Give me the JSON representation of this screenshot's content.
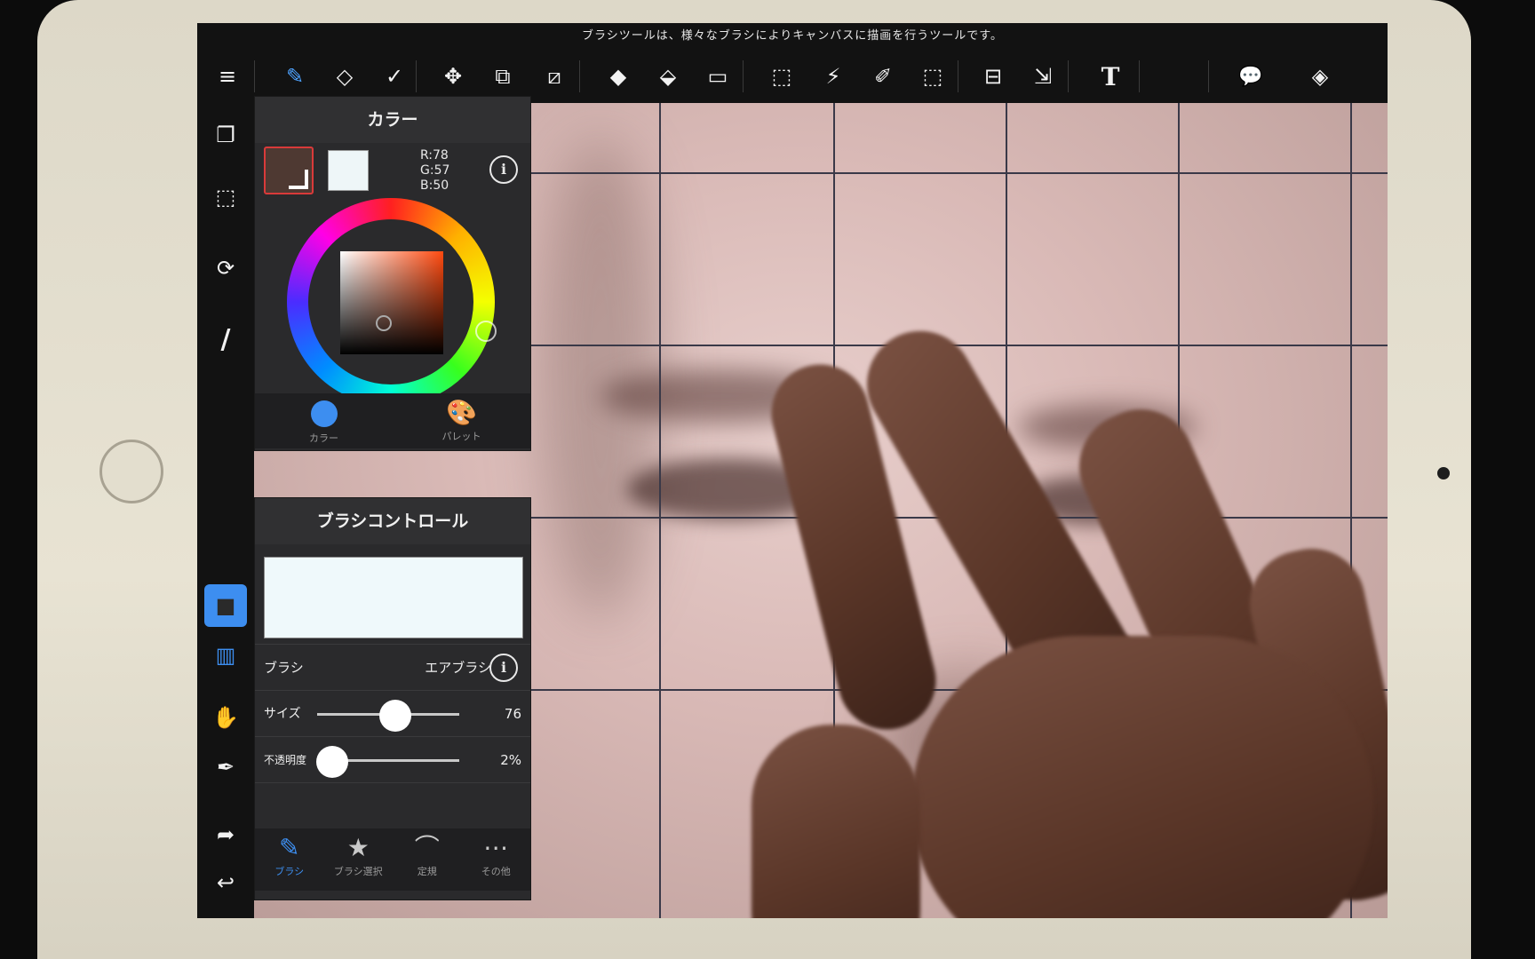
{
  "tipbar": {
    "text": "ブラシツールは、様々なブラシによりキャンバスに描画を行うツールです。"
  },
  "toolbar": {
    "items": [
      {
        "name": "menu-icon",
        "glyph": "≡"
      },
      {
        "name": "brush-icon",
        "glyph": "✎"
      },
      {
        "name": "eraser-icon",
        "glyph": "◇"
      },
      {
        "name": "smudge-icon",
        "glyph": "✓"
      },
      {
        "name": "move-icon",
        "glyph": "✥"
      },
      {
        "name": "transform-icon",
        "glyph": "⧉"
      },
      {
        "name": "distort-icon",
        "glyph": "⧄"
      },
      {
        "name": "shape-fill-icon",
        "glyph": "◆"
      },
      {
        "name": "bucket-icon",
        "glyph": "⬙"
      },
      {
        "name": "gradient-icon",
        "glyph": "▭"
      },
      {
        "name": "select-rect-icon",
        "glyph": "⬚"
      },
      {
        "name": "magic-wand-icon",
        "glyph": "⚡"
      },
      {
        "name": "select-pen-icon",
        "glyph": "✐"
      },
      {
        "name": "select-eraser-icon",
        "glyph": "⬚"
      },
      {
        "name": "frame-icon",
        "glyph": "⊟"
      },
      {
        "name": "select-move-icon",
        "glyph": "⇲"
      },
      {
        "name": "text-icon",
        "glyph": "T"
      },
      {
        "name": "speech-bubble-icon",
        "glyph": "💬"
      },
      {
        "name": "layers-icon",
        "glyph": "◈"
      }
    ]
  },
  "rail": {
    "items": [
      {
        "name": "copy-icon",
        "glyph": "❐"
      },
      {
        "name": "selection-icon",
        "glyph": "⬚"
      },
      {
        "name": "rotate-icon",
        "glyph": "⟳"
      },
      {
        "name": "pen-icon",
        "glyph": "/"
      },
      {
        "name": "color-square-icon",
        "glyph": "■"
      },
      {
        "name": "panel-toggle-icon",
        "glyph": "▥"
      },
      {
        "name": "hand-icon",
        "glyph": "✋"
      },
      {
        "name": "eyedropper-icon",
        "glyph": "✒"
      },
      {
        "name": "redo-icon",
        "glyph": "➦"
      },
      {
        "name": "undo-icon",
        "glyph": "↩"
      }
    ]
  },
  "color_panel": {
    "title": "カラー",
    "fg_color": "#4e3932",
    "bg_color": "#eef6f8",
    "rgb": {
      "r": "R:78",
      "g": "G:57",
      "b": "B:50"
    },
    "info": "i",
    "tabs": [
      {
        "label": "カラー"
      },
      {
        "label": "パレット"
      }
    ]
  },
  "brush_panel": {
    "title": "ブラシコントロール",
    "brush_label": "ブラシ",
    "brush_value": "エアブラシ",
    "info": "i",
    "size_label": "サイズ",
    "size_value": "76",
    "size_fraction": 0.55,
    "opacity_label": "不透明度",
    "opacity_value": "2%",
    "opacity_fraction": 0.02,
    "tabs": [
      {
        "label": "ブラシ"
      },
      {
        "label": "ブラシ選択"
      },
      {
        "label": "定規"
      },
      {
        "label": "その他"
      }
    ]
  },
  "colors": {
    "accent": "#3d8ef0",
    "selected_outline": "#d93a3a"
  }
}
